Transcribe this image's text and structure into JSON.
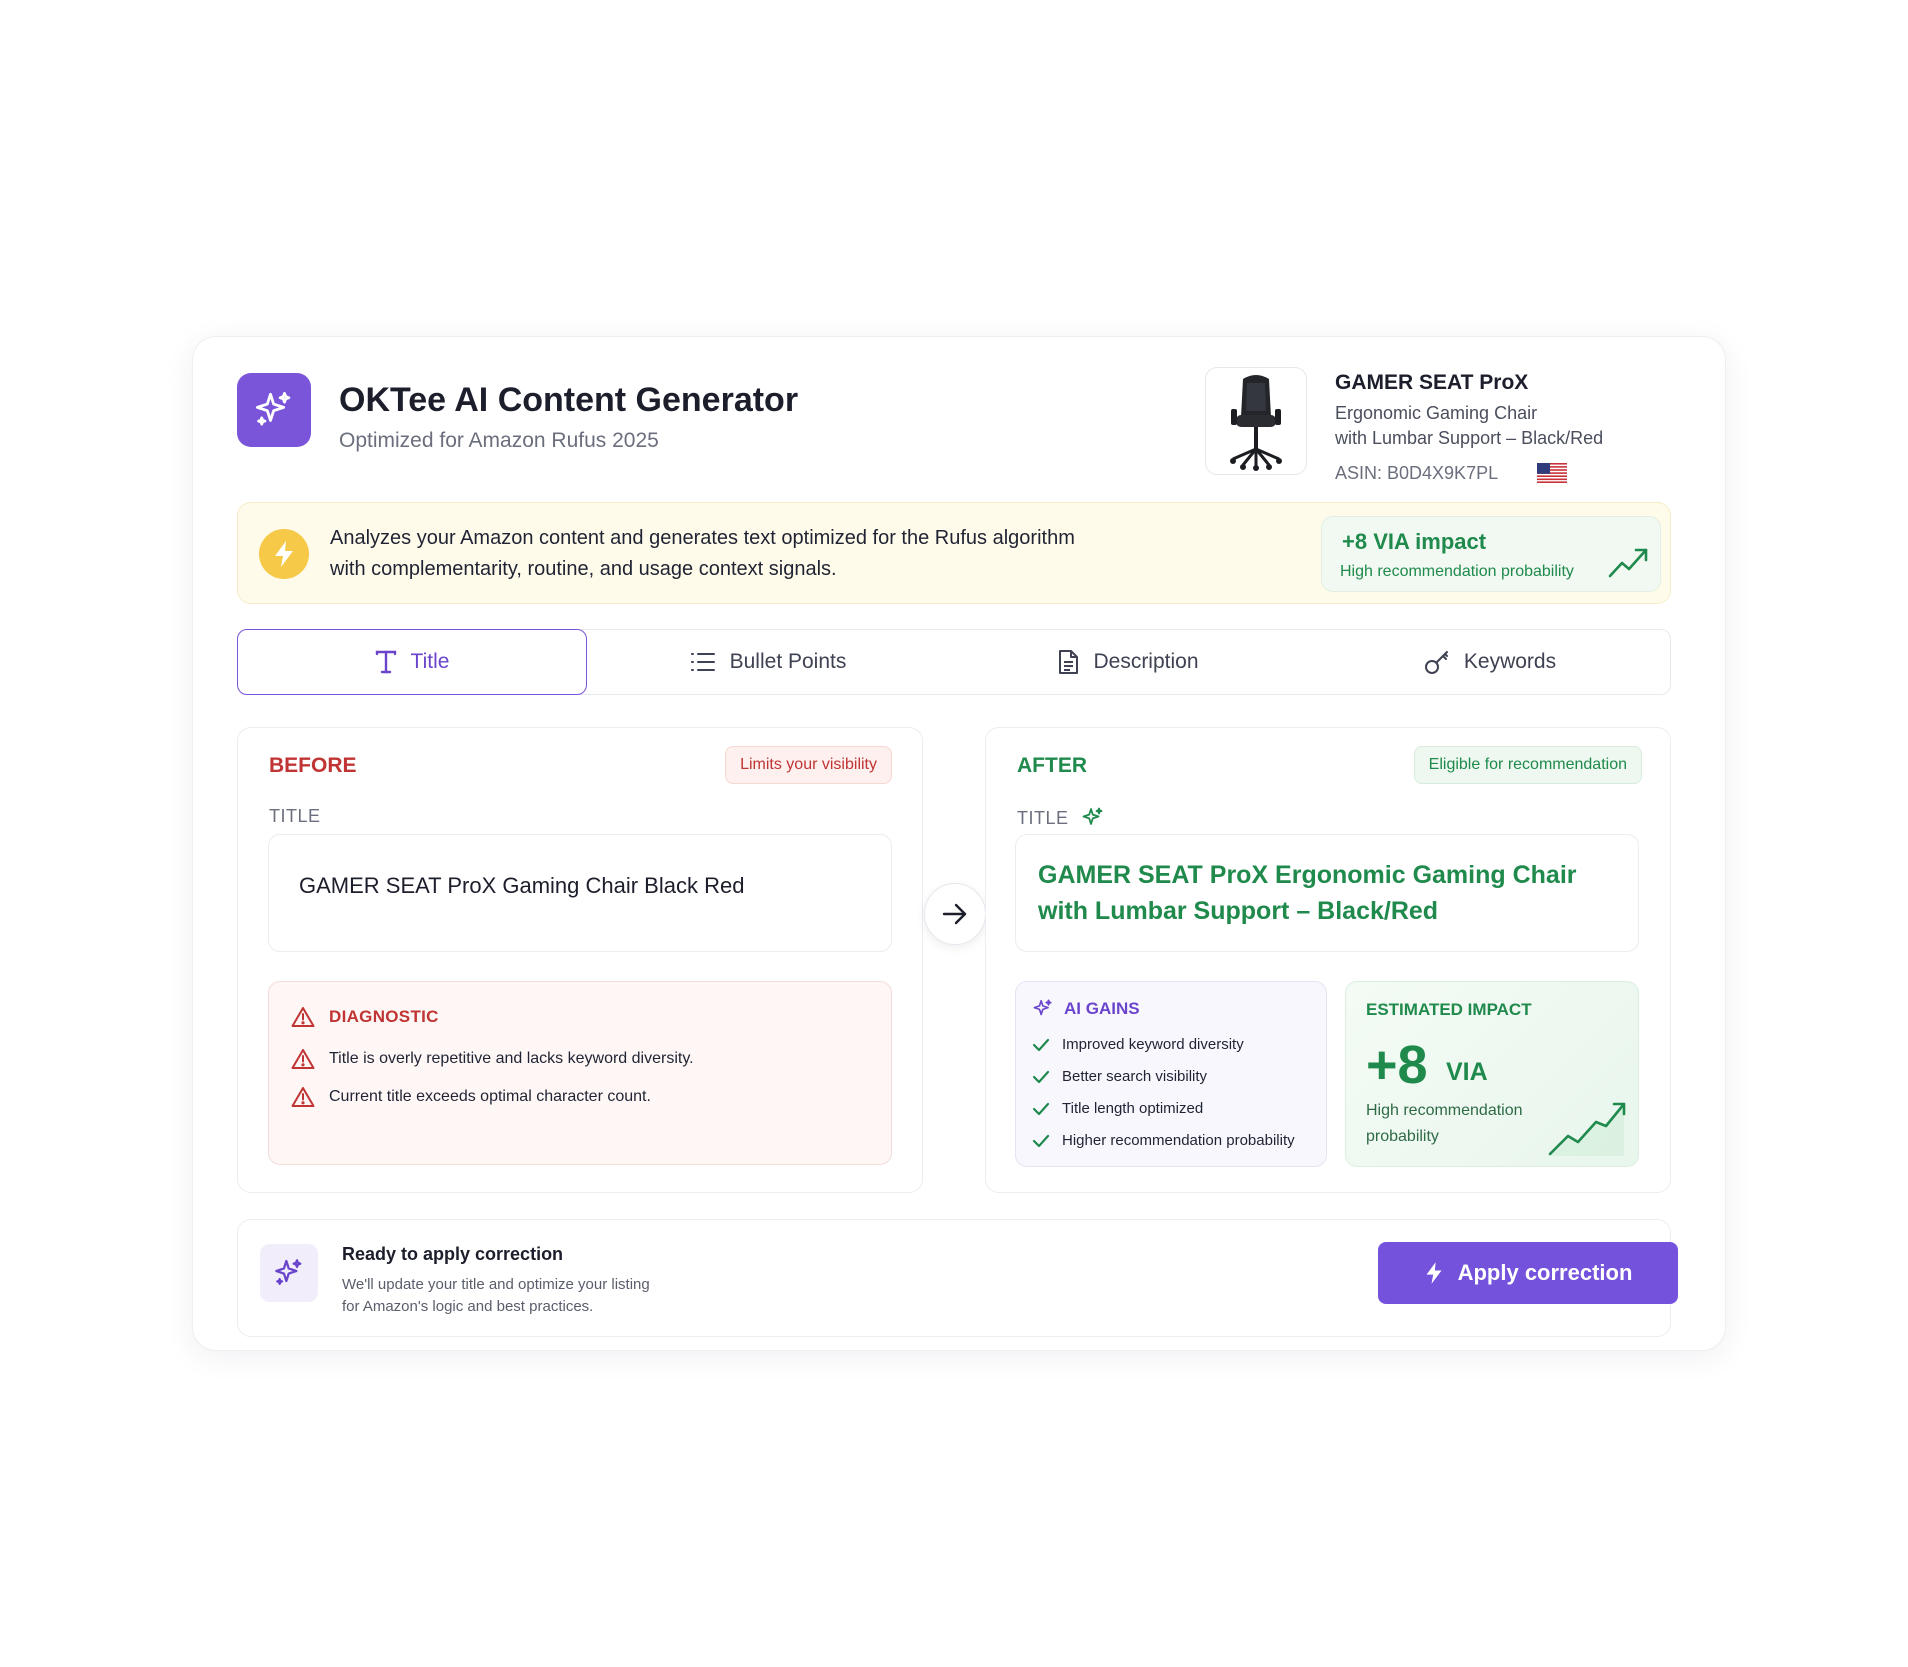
{
  "header": {
    "app_title": "OKTee AI Content Generator",
    "app_subtitle": "Optimized for Amazon Rufus 2025",
    "logo_icon": "sparkles-icon"
  },
  "product": {
    "name": "GAMER SEAT ProX",
    "desc_line1": "Ergonomic Gaming Chair",
    "desc_line2": "with Lumbar Support – Black/Red",
    "asin": "ASIN: B0D4X9K7PL",
    "marketplace_flag": "us-flag-icon"
  },
  "banner": {
    "text_line1": "Analyzes your Amazon content and generates text optimized for the Rufus algorithm",
    "text_line2": "with complementarity, routine, and usage context signals.",
    "impact_value": "+8 VIA impact",
    "impact_label": "High recommendation probability"
  },
  "tabs": [
    {
      "label": "Title",
      "icon": "text-icon",
      "active": true
    },
    {
      "label": "Bullet Points",
      "icon": "list-icon",
      "active": false
    },
    {
      "label": "Description",
      "icon": "document-icon",
      "active": false
    },
    {
      "label": "Keywords",
      "icon": "key-icon",
      "active": false
    }
  ],
  "before": {
    "heading": "BEFORE",
    "badge": "Limits your visibility",
    "field_label": "TITLE",
    "title_text": "GAMER SEAT ProX Gaming Chair Black Red",
    "diagnostic": {
      "title": "DIAGNOSTIC",
      "items": [
        "Title is overly repetitive and lacks keyword diversity.",
        "Current title exceeds optimal character count."
      ]
    }
  },
  "after": {
    "heading": "AFTER",
    "badge": "Eligible for recommendation",
    "field_label": "TITLE",
    "title_line1": "GAMER SEAT ProX Ergonomic Gaming Chair",
    "title_line2": "with Lumbar Support – Black/Red",
    "gains": {
      "title": "AI GAINS",
      "items": [
        "Improved keyword diversity",
        "Better search visibility",
        "Title length optimized",
        "Higher recommendation probability"
      ]
    },
    "impact": {
      "title": "ESTIMATED IMPACT",
      "value": "+8",
      "unit": "VIA",
      "label_line1": "High recommendation",
      "label_line2": "probability"
    }
  },
  "footer": {
    "title": "Ready to apply correction",
    "text_line1": "We'll update your title and optimize your listing",
    "text_line2": "for Amazon's logic and best practices.",
    "button_label": "Apply correction"
  },
  "colors": {
    "brand_purple": "#7b55d9",
    "success_green": "#1f8a4c",
    "danger_red": "#c03434",
    "banner_yellow": "#f7c948"
  }
}
